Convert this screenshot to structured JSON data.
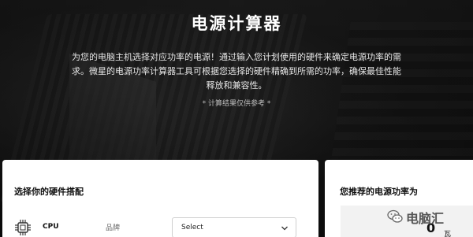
{
  "hero": {
    "title": "电源计算器",
    "description": "为您的电脑主机选择对应功率的电源！通过输入您计划使用的硬件来确定电源功率的需求。微星的电源功率计算器工具可根据您选择的硬件精确到所需的功率，确保最佳性能释放和兼容性。",
    "note": "* 计算结果仅供参考 *"
  },
  "hardware_panel": {
    "title": "选择你的硬件搭配",
    "cpu": {
      "label": "CPU",
      "brand_label": "品牌",
      "select_value": "Select",
      "icon": "cpu-chip-icon"
    }
  },
  "result_panel": {
    "title": "您推荐的电源功率为",
    "value": "0",
    "unit": "瓦"
  },
  "watermark": {
    "text": "电脑汇",
    "icon": "wechat-icon"
  },
  "colors": {
    "hero_bg": "#141414",
    "panel_bg": "#ffffff",
    "result_bg": "#f2f2f2",
    "text_dark": "#111111"
  }
}
